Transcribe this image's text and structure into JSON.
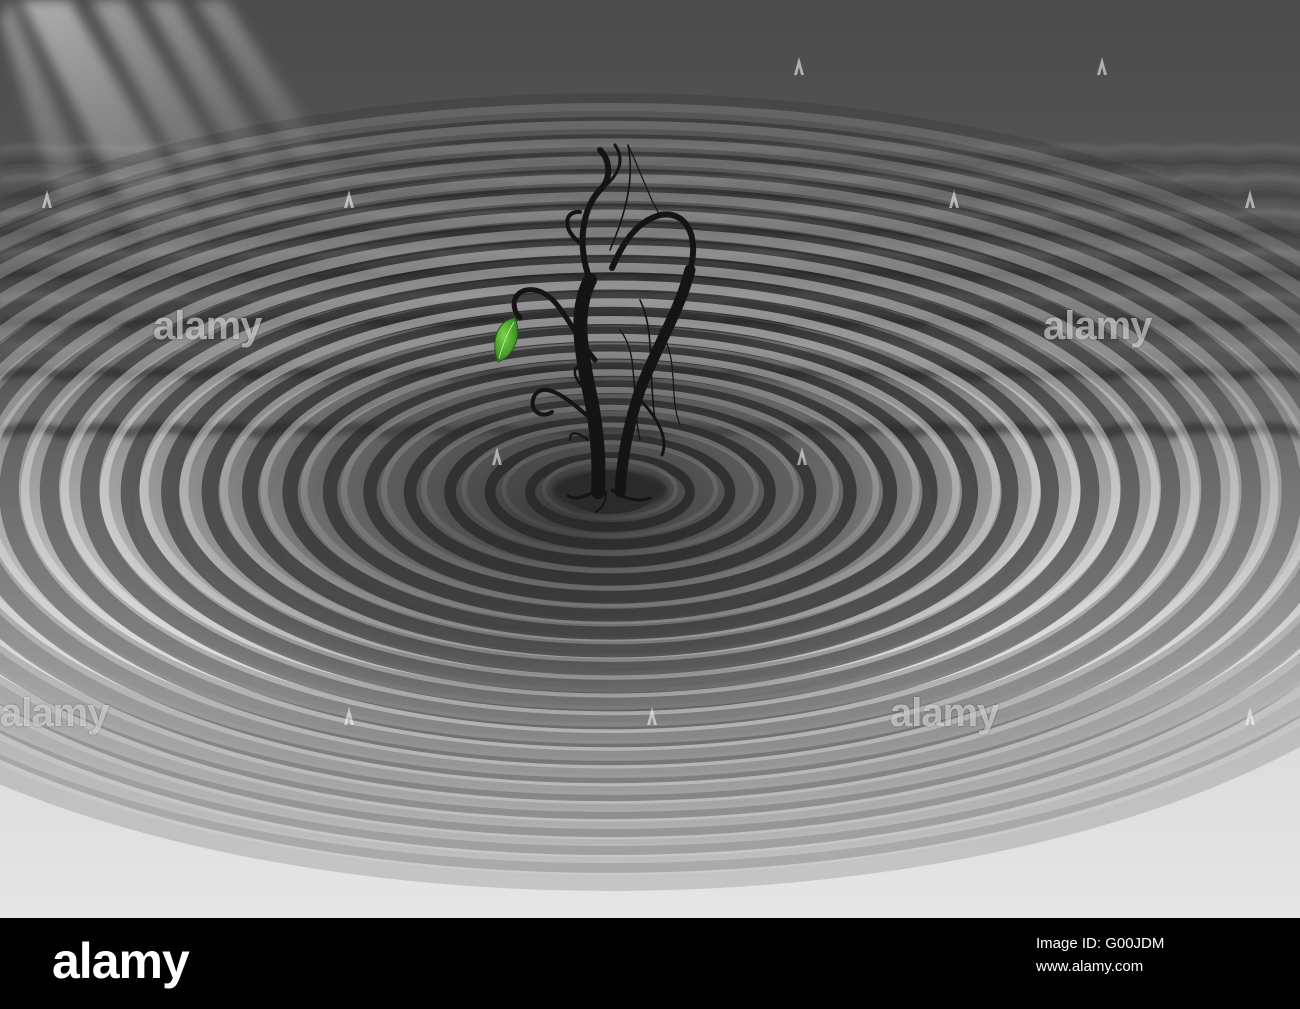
{
  "watermark": {
    "text": "alamy"
  },
  "footer": {
    "logo": "alamy",
    "image_id_line": "Image ID: G00JDM",
    "url_line": "www.alamy.com"
  },
  "colors": {
    "leaf": "#3f9a2a",
    "ripple_dark": "#1a1a1a",
    "ripple_light": "#e8e8e8",
    "background_top": "#4a4a4a",
    "footer": "#000000"
  }
}
